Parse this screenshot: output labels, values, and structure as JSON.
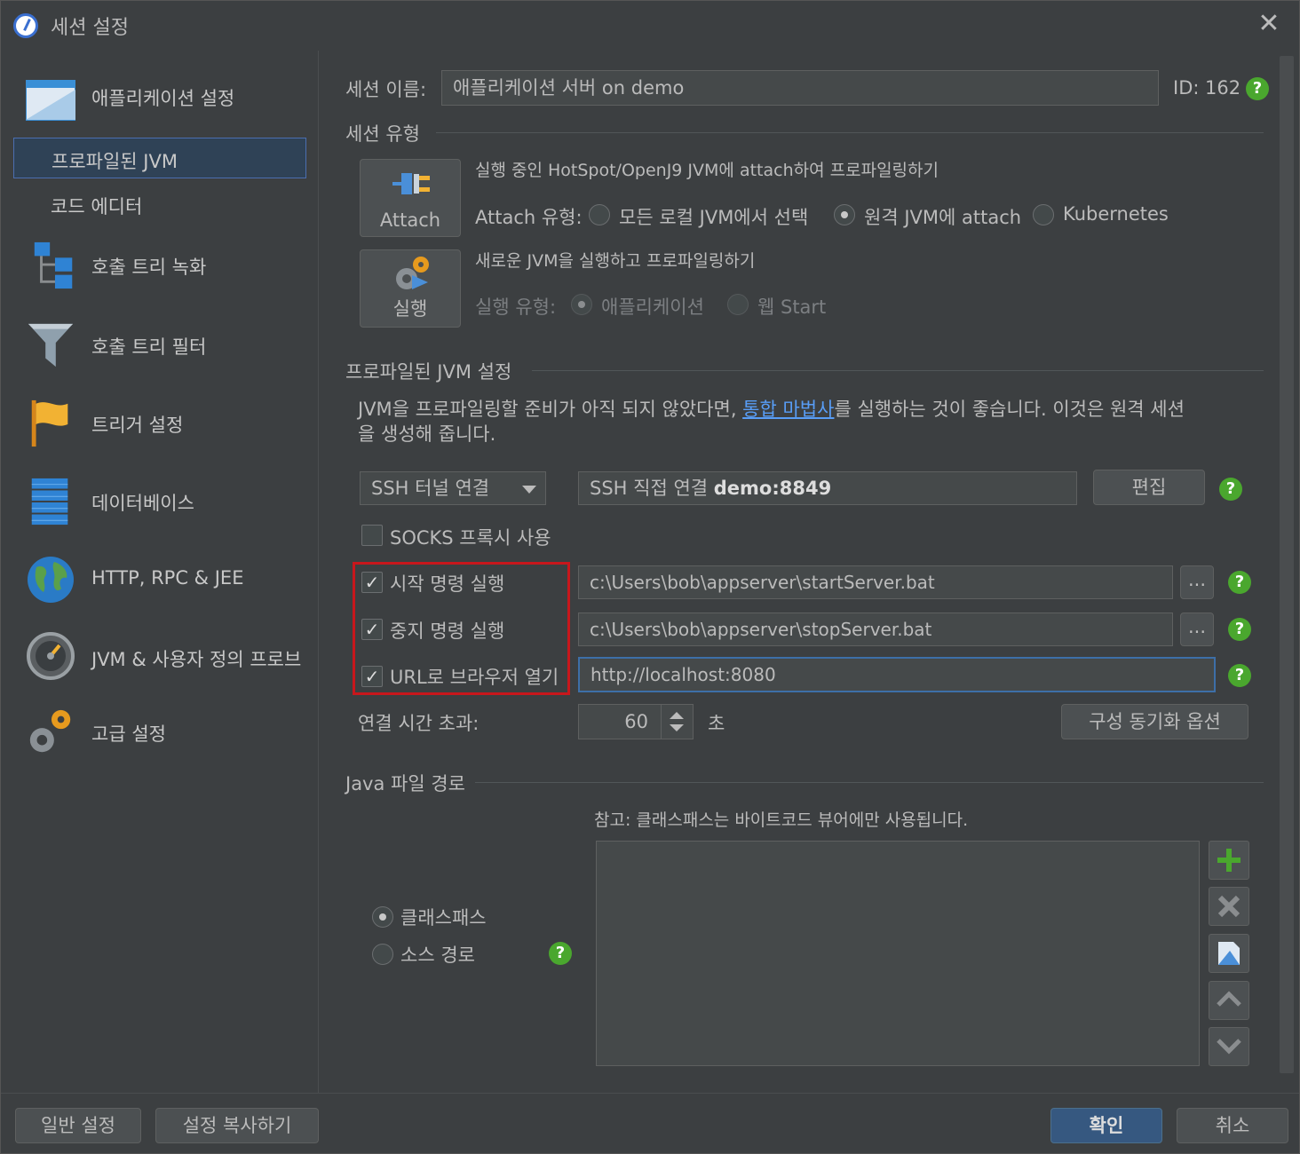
{
  "window": {
    "title": "세션 설정",
    "close": "✕"
  },
  "sidebar": {
    "items": [
      {
        "label": "애플리케이션 설정",
        "icon": "window-icon"
      },
      {
        "label": "프로파일된 JVM",
        "selected": true
      },
      {
        "label": "코드 에디터"
      },
      {
        "label": "호출 트리 녹화",
        "icon": "tree-icon"
      },
      {
        "label": "호출 트리 필터",
        "icon": "funnel-icon"
      },
      {
        "label": "트리거 설정",
        "icon": "flag-icon"
      },
      {
        "label": "데이터베이스",
        "icon": "database-icon"
      },
      {
        "label": "HTTP, RPC & JEE",
        "icon": "globe-icon"
      },
      {
        "label": "JVM & 사용자 정의 프로브",
        "icon": "gauge-icon"
      },
      {
        "label": "고급 설정",
        "icon": "gears-icon"
      }
    ]
  },
  "session": {
    "name_label": "세션 이름:",
    "name_value": "애플리케이션 서버 on demo",
    "id_label": "ID:",
    "id_value": "162"
  },
  "session_type": {
    "heading": "세션 유형",
    "attach_button": "Attach",
    "attach_desc": "실행 중인 HotSpot/OpenJ9 JVM에 attach하여 프로파일링하기",
    "attach_type_label": "Attach 유형:",
    "attach_options": [
      "모든 로컬 JVM에서 선택",
      "원격 JVM에 attach",
      "Kubernetes"
    ],
    "attach_selected": 1,
    "run_button": "실행",
    "run_desc": "새로운 JVM을 실행하고 프로파일링하기",
    "run_type_label": "실행 유형:",
    "run_options": [
      "애플리케이션",
      "웹 Start"
    ],
    "run_selected": 0
  },
  "profiled_jvm": {
    "heading": "프로파일된 JVM 설정",
    "info_before": "JVM을 프로파일링할 준비가 아직 되지 않았다면, ",
    "info_link": "통합 마법사",
    "info_after": "를 실행하는 것이 좋습니다. 이것은 원격 세션",
    "info_line2": "을 생성해 줍니다.",
    "connection_select": "SSH 터널 연결",
    "connection_prefix": "SSH 직접 연결 ",
    "connection_host": "demo:8849",
    "edit_button": "편집",
    "socks_label": "SOCKS 프록시 사용",
    "socks_checked": false,
    "start_cmd_label": "시작 명령 실행",
    "start_cmd_value": "c:\\Users\\bob\\appserver\\startServer.bat",
    "stop_cmd_label": "중지 명령 실행",
    "stop_cmd_value": "c:\\Users\\bob\\appserver\\stopServer.bat",
    "browser_label": "URL로 브라우저 열기",
    "browser_value": "http://localhost:8080",
    "browse_button": "...",
    "check_mark": "✓",
    "timeout_label": "연결 시간 초과:",
    "timeout_value": "60",
    "timeout_unit": "초",
    "sync_button": "구성 동기화 옵션"
  },
  "java_path": {
    "heading": "Java 파일 경로",
    "note": "참고: 클래스패스는 바이트코드 뷰어에만 사용됩니다.",
    "options": [
      "클래스패스",
      "소스 경로"
    ],
    "selected": 0
  },
  "footer": {
    "general_button": "일반 설정",
    "copy_button": "설정 복사하기",
    "ok_button": "확인",
    "cancel_button": "취소"
  },
  "help_glyph": "?",
  "colors": {
    "accent": "#365880",
    "help": "#4aa72e",
    "highlight": "#c8171c",
    "link": "#589df6"
  }
}
